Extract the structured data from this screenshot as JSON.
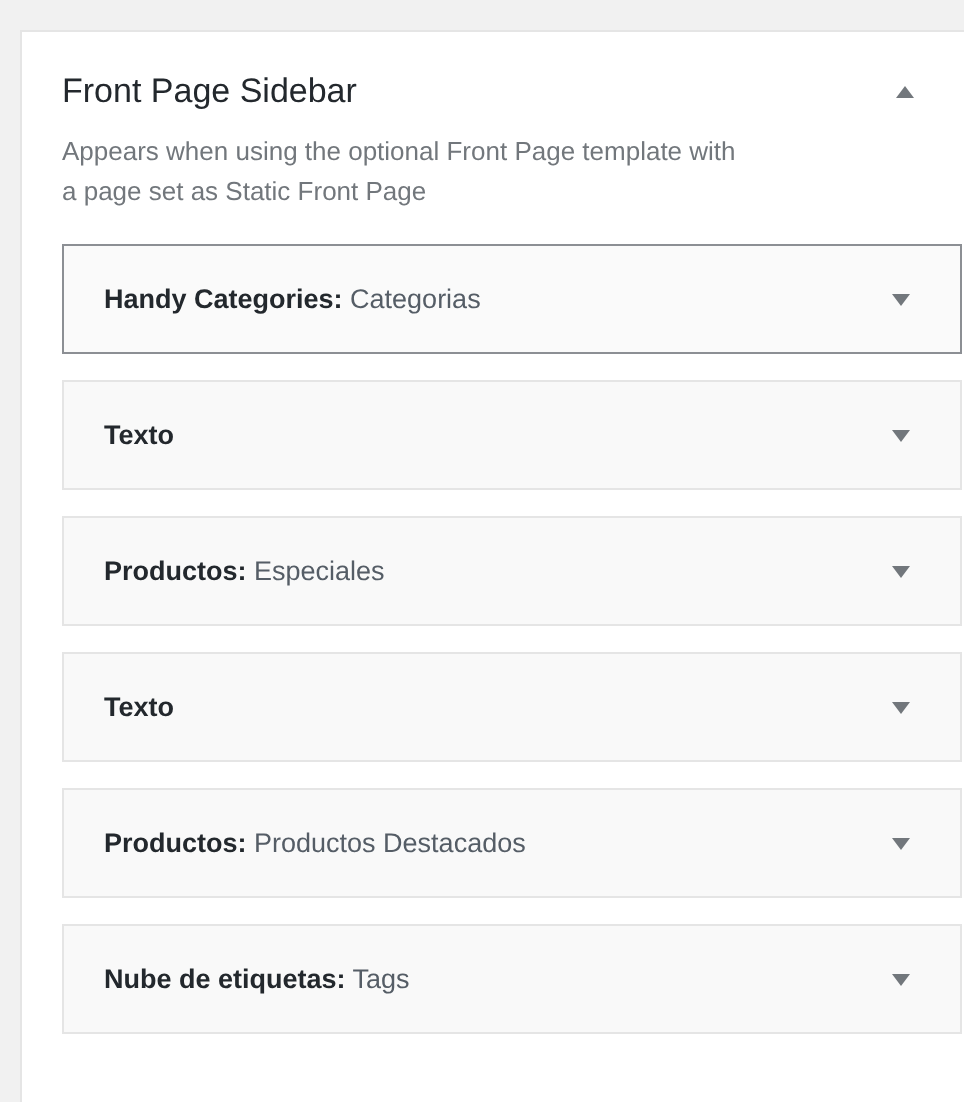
{
  "sidebar": {
    "title": "Front Page Sidebar",
    "expanded": true,
    "description": "Appears when using the optional Front Page template with a page set as Static Front Page",
    "widgets": [
      {
        "label": "**Handy Categories:** Categorias",
        "selected": true
      },
      {
        "label": "**Texto**",
        "selected": false
      },
      {
        "label": "**Productos:** Especiales",
        "selected": false
      },
      {
        "label": "**Texto**",
        "selected": false
      },
      {
        "label": "**Productos:** Productos Destacados",
        "selected": false
      },
      {
        "label": "**Nube de etiquetas:** Tags",
        "selected": false
      }
    ]
  }
}
